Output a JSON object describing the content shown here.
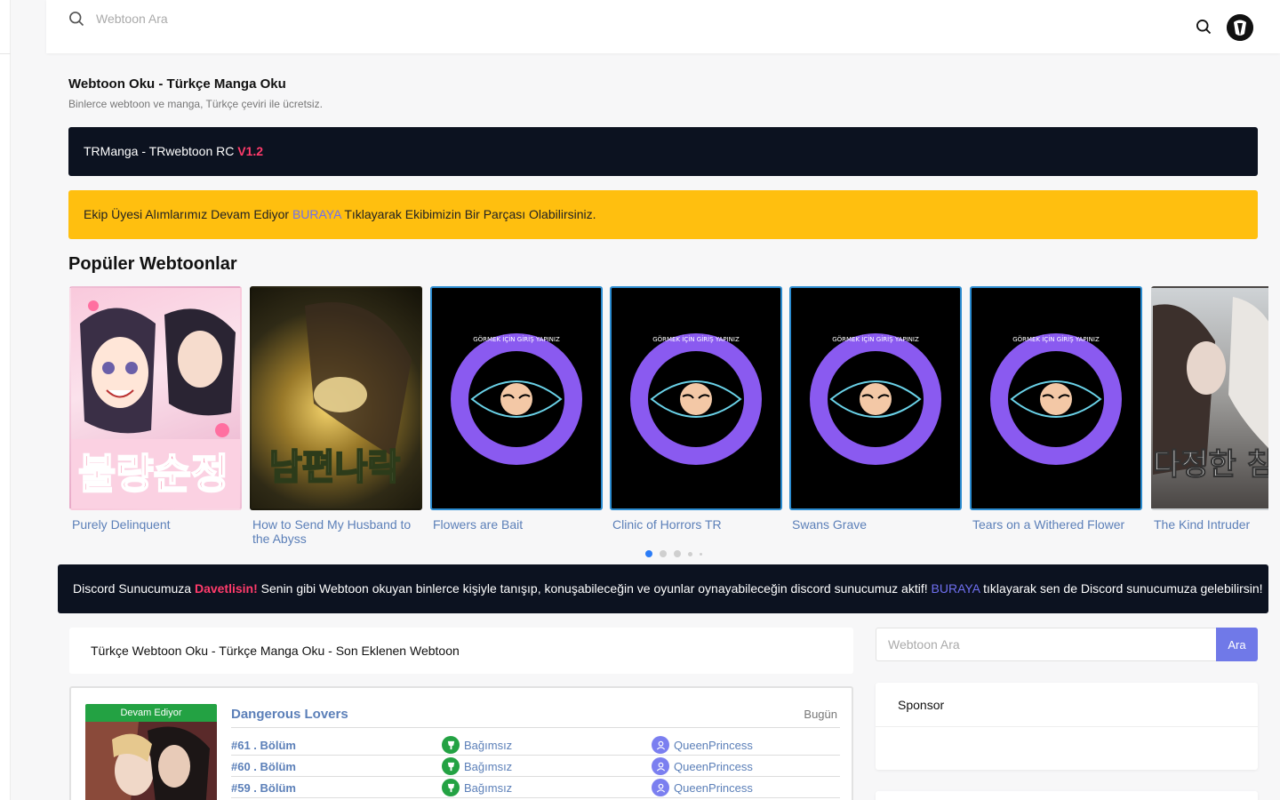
{
  "header": {
    "search_placeholder": "Webtoon Ara"
  },
  "site": {
    "title": "Webtoon Oku - Türkçe Manga Oku",
    "subtitle": "Binlerce webtoon ve manga, Türkçe çeviri ile ücretsiz."
  },
  "version_banner": {
    "text": "TRManga - TRwebtoon RC ",
    "version": "V1.2"
  },
  "recruit_banner": {
    "before": "Ekip Üyesi Alımlarımız Devam Ediyor ",
    "link": "BURAYA",
    "after": " Tıklayarak Ekibimizin Bir Parçası Olabilirsiniz."
  },
  "popular": {
    "heading": "Popüler Webtoonlar",
    "items": [
      {
        "title": "Purely Delinquent",
        "cover_text": "불량순정"
      },
      {
        "title": "How to Send My Husband to the Abyss",
        "cover_text": "남편나락"
      },
      {
        "title": "Flowers are Bait",
        "cover_text": "GÖRMEK İÇİN GİRİŞ YAPINIZ"
      },
      {
        "title": "Clinic of Horrors TR",
        "cover_text": "GÖRMEK İÇİN GİRİŞ YAPINIZ"
      },
      {
        "title": "Swans Grave",
        "cover_text": "GÖRMEK İÇİN GİRİŞ YAPINIZ"
      },
      {
        "title": "Tears on a Withered Flower",
        "cover_text": "GÖRMEK İÇİN GİRİŞ YAPINIZ"
      },
      {
        "title": "The Kind Intruder",
        "cover_text": "다정한 침입자"
      }
    ],
    "pagination_active": 1
  },
  "discord_banner": {
    "before": "Discord Sunucumuza ",
    "highlight": "Davetlisin!",
    "middle": " Senin gibi Webtoon okuyan binlerce kişiyle tanışıp, konuşabileceğin ve oyunlar oynayabileceğin discord sunucumuz aktif! ",
    "link": "BURAYA",
    "after": " tıklayarak sen de Discord sunucumuza gelebilirsin!"
  },
  "latest": {
    "heading": "Türkçe Webtoon Oku - Türkçe Manga Oku - Son Eklenen Webtoon",
    "entry": {
      "status": "Devam Ediyor",
      "title": "Dangerous Lovers",
      "date": "Bugün",
      "chapters": [
        {
          "chapter": "#61 . Bölüm",
          "group": "Bağımsız",
          "user": "QueenPrincess"
        },
        {
          "chapter": "#60 . Bölüm",
          "group": "Bağımsız",
          "user": "QueenPrincess"
        },
        {
          "chapter": "#59 . Bölüm",
          "group": "Bağımsız",
          "user": "QueenPrincess"
        }
      ]
    }
  },
  "sidebar": {
    "search_placeholder": "Webtoon Ara",
    "search_button": "Ara",
    "sponsor_heading": "Sponsor"
  },
  "colors": {
    "dark_banner": "#0c1220",
    "yellow_banner": "#ffbf0f",
    "accent_red": "#ff3b6b",
    "link_purple": "#6f6ff0",
    "title_blue": "#5b7fb8",
    "status_green": "#23a243",
    "search_button": "#7079e8"
  },
  "icons": [
    "search-icon",
    "avatar-logo",
    "group-icon",
    "user-icon"
  ]
}
